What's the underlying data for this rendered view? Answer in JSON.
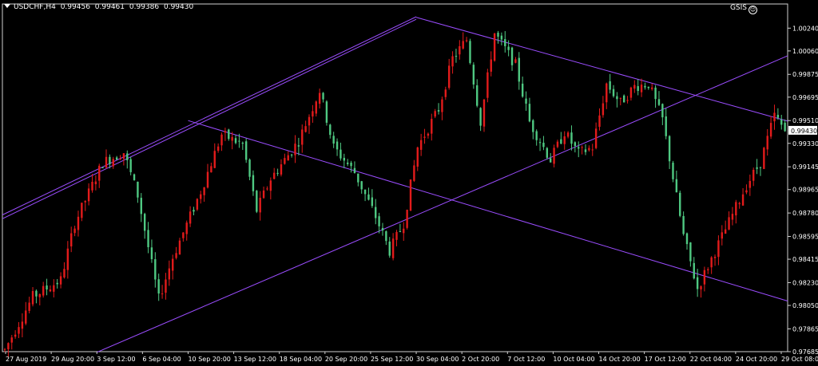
{
  "header": {
    "symbol": "USDCHF,H4",
    "open": "0.99456",
    "high": "0.99461",
    "low": "0.99386",
    "close": "0.99430"
  },
  "brand": {
    "label": "GSIS"
  },
  "colors": {
    "background": "#000000",
    "bull": "#e21b1b",
    "bear": "#4fc982",
    "trendline": "#9b4dff",
    "axis": "#d0d0d0"
  },
  "chart_data": {
    "type": "candlestick",
    "title": "USDCHF,H4",
    "ylim": [
      0.97685,
      1.0033
    ],
    "y_ticks": [
      "1.00240",
      "1.00060",
      "0.99875",
      "0.99695",
      "0.99510",
      "0.99330",
      "0.99145",
      "0.98965",
      "0.98780",
      "0.98595",
      "0.98415",
      "0.98230",
      "0.98050",
      "0.97865",
      "0.97685"
    ],
    "x_ticks": [
      "27 Aug 2019",
      "29 Aug 20:00",
      "3 Sep 12:00",
      "6 Sep 04:00",
      "10 Sep 20:00",
      "13 Sep 12:00",
      "18 Sep 04:00",
      "20 Sep 20:00",
      "25 Sep 12:00",
      "30 Sep 04:00",
      "2 Oct 20:00",
      "7 Oct 12:00",
      "10 Oct 04:00",
      "14 Oct 20:00",
      "17 Oct 12:00",
      "22 Oct 04:00",
      "24 Oct 20:00",
      "29 Oct 08:00"
    ],
    "last_price": "0.99430",
    "bar_count": 224,
    "price_path": [
      [
        0,
        0.977
      ],
      [
        8,
        0.9812
      ],
      [
        16,
        0.9825
      ],
      [
        20,
        0.987
      ],
      [
        28,
        0.9918
      ],
      [
        34,
        0.9926
      ],
      [
        38,
        0.9892
      ],
      [
        44,
        0.981
      ],
      [
        48,
        0.9843
      ],
      [
        56,
        0.9895
      ],
      [
        62,
        0.994
      ],
      [
        68,
        0.9932
      ],
      [
        72,
        0.988
      ],
      [
        76,
        0.9905
      ],
      [
        84,
        0.9935
      ],
      [
        90,
        0.9975
      ],
      [
        94,
        0.993
      ],
      [
        100,
        0.991
      ],
      [
        106,
        0.9875
      ],
      [
        110,
        0.9848
      ],
      [
        114,
        0.987
      ],
      [
        118,
        0.993
      ],
      [
        124,
        0.996
      ],
      [
        128,
        1.0
      ],
      [
        132,
        1.0015
      ],
      [
        136,
        0.995
      ],
      [
        140,
        1.002
      ],
      [
        146,
        0.9995
      ],
      [
        150,
        0.995
      ],
      [
        156,
        0.992
      ],
      [
        160,
        0.9942
      ],
      [
        164,
        0.9925
      ],
      [
        168,
        0.993
      ],
      [
        172,
        0.998
      ],
      [
        176,
        0.9965
      ],
      [
        180,
        0.9978
      ],
      [
        184,
        0.998
      ],
      [
        188,
        0.9952
      ],
      [
        194,
        0.986
      ],
      [
        198,
        0.9818
      ],
      [
        202,
        0.9842
      ],
      [
        206,
        0.9865
      ],
      [
        212,
        0.99
      ],
      [
        216,
        0.9918
      ],
      [
        220,
        0.9955
      ],
      [
        223,
        0.9943
      ]
    ],
    "trendlines": [
      {
        "name": "upper-channel-1",
        "from": [
          "27 Aug 2019",
          0.98765
        ],
        "to": [
          "30 Sep 04:00",
          1.0033
        ]
      },
      {
        "name": "upper-channel-2",
        "from": [
          "27 Aug 2019",
          0.98735
        ],
        "to": [
          "30 Sep 04:00",
          1.0031
        ]
      },
      {
        "name": "descending-top",
        "from": [
          "30 Sep 04:00",
          1.00325
        ],
        "to": [
          "29 Oct 08:00",
          0.9952
        ]
      },
      {
        "name": "descending-mid",
        "from": [
          "10 Sep 20:00",
          0.9951
        ],
        "to": [
          "29 Oct 08:00",
          0.981
        ]
      },
      {
        "name": "ascending-support",
        "from": [
          "3 Sep 12:00",
          0.9768
        ],
        "to": [
          "29 Oct 08:00",
          1.0
        ]
      }
    ]
  }
}
